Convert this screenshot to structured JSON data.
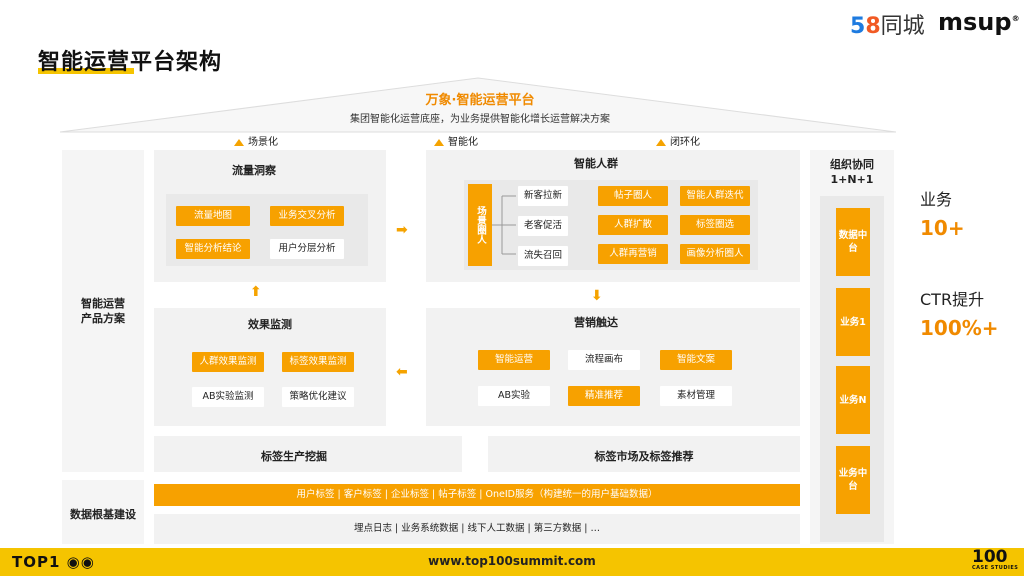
{
  "header": {
    "title": "智能运营平台架构",
    "logo_58_digits5": "5",
    "logo_58_digits8": "8",
    "logo_58_text": "同城",
    "logo_msup": "msup",
    "logo_msup_mark": "®"
  },
  "roof": {
    "title": "万象·智能运营平台",
    "subtitle": "集团智能化运营底座，为业务提供智能化增长运营解决方案"
  },
  "pillars": [
    "场景化",
    "智能化",
    "闭环化"
  ],
  "left_side": {
    "product_label_line1": "智能运营",
    "product_label_line2": "产品方案",
    "data_label": "数据根基建设"
  },
  "traffic": {
    "title": "流量洞察",
    "chips": [
      "流量地图",
      "业务交叉分析",
      "智能分析结论",
      "用户分层分析"
    ]
  },
  "crowd": {
    "title": "智能人群",
    "scene_label": "场景圈人",
    "scenes": [
      "新客拉新",
      "老客促活",
      "流失召回"
    ],
    "chips": [
      "帖子圈人",
      "智能人群迭代",
      "人群扩散",
      "标签圈选",
      "人群再营销",
      "画像分析圈人"
    ]
  },
  "effect": {
    "title": "效果监测",
    "chips": [
      "人群效果监测",
      "标签效果监测",
      "AB实验监测",
      "策略优化建议"
    ]
  },
  "marketing": {
    "title": "营销触达",
    "chips": [
      "智能运营",
      "流程画布",
      "智能文案",
      "AB实验",
      "精准推荐",
      "素材管理"
    ]
  },
  "tag_row": {
    "left": "标签生产挖掘",
    "right": "标签市场及标签推荐"
  },
  "data_bars": {
    "orange": "用户标签 | 客户标签 | 企业标签 | 帖子标签 | OneID服务（构建统一的用户基础数据）",
    "grey": "埋点日志 | 业务系统数据 | 线下人工数据 | 第三方数据 | …"
  },
  "right_col": {
    "title_line1": "组织协同",
    "title_line2": "1+N+1",
    "items": [
      "数据中台",
      "业务1",
      "业务N",
      "业务中台"
    ]
  },
  "stats": [
    {
      "label": "业务",
      "value": "10+"
    },
    {
      "label": "CTR提升",
      "value": "100%+"
    }
  ],
  "footer": {
    "url": "www.top100summit.com",
    "left_logo": "TOP1",
    "right_logo": "100",
    "right_logo_sub": "CASE STUDIES"
  },
  "colors": {
    "accent_orange": "#F7A100",
    "title_orange": "#F08A00",
    "footer_yellow": "#F5C400"
  }
}
